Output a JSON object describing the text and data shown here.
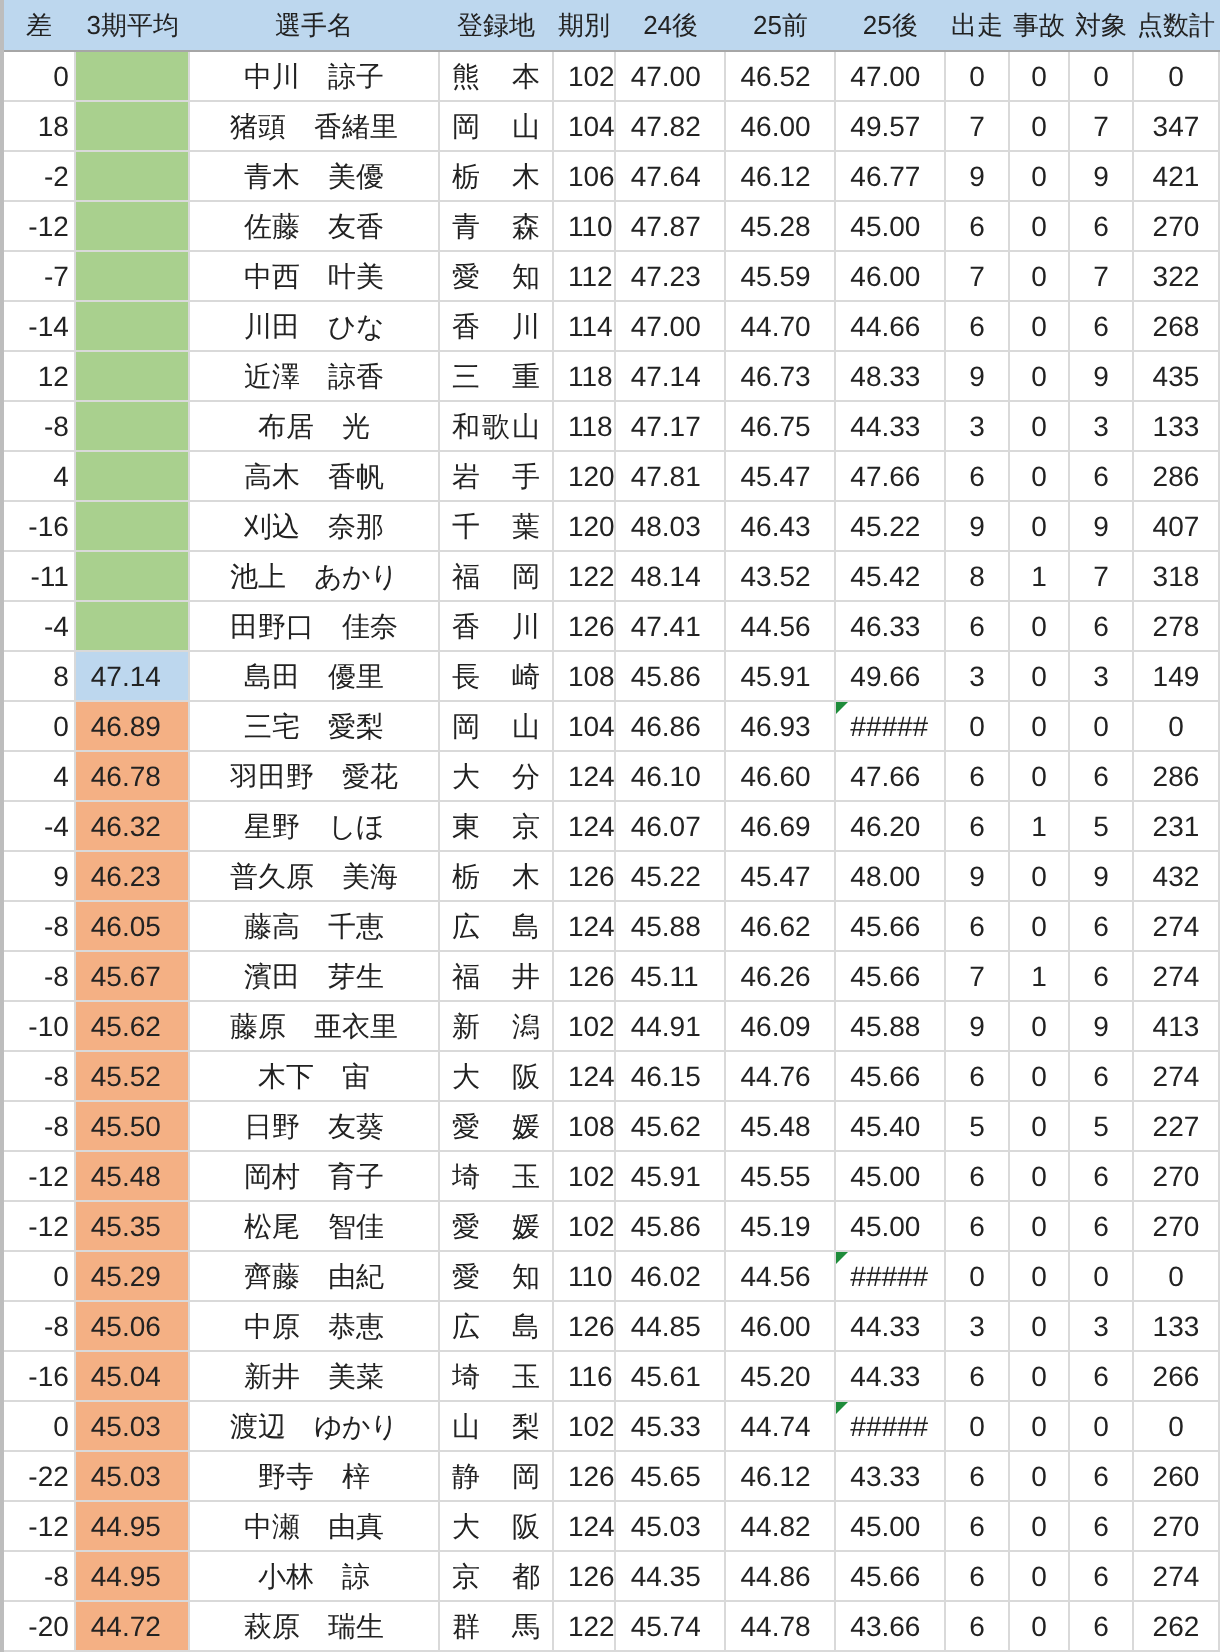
{
  "columns": [
    "差",
    "3期平均",
    "選手名",
    "登録地",
    "期別",
    "24後",
    "25前",
    "25後",
    "出走",
    "事故",
    "対象",
    "点数計"
  ],
  "rows": [
    {
      "diff": "0",
      "color": "#a9d08e",
      "name": "中川　諒子",
      "pref": "熊　本",
      "term": "102",
      "h24": "47.00",
      "f25": "46.52",
      "h25": "47.00",
      "flag": false,
      "starts": "0",
      "accidents": "0",
      "target": "0",
      "points": "0"
    },
    {
      "diff": "18",
      "color": "#a9d08e",
      "name": "猪頭　香緒里",
      "pref": "岡　山",
      "term": "104",
      "h24": "47.82",
      "f25": "46.00",
      "h25": "49.57",
      "flag": false,
      "starts": "7",
      "accidents": "0",
      "target": "7",
      "points": "347"
    },
    {
      "diff": "-2",
      "color": "#a9d08e",
      "name": "青木　美優",
      "pref": "栃　木",
      "term": "106",
      "h24": "47.64",
      "f25": "46.12",
      "h25": "46.77",
      "flag": false,
      "starts": "9",
      "accidents": "0",
      "target": "9",
      "points": "421"
    },
    {
      "diff": "-12",
      "color": "#a9d08e",
      "name": "佐藤　友香",
      "pref": "青　森",
      "term": "110",
      "h24": "47.87",
      "f25": "45.28",
      "h25": "45.00",
      "flag": false,
      "starts": "6",
      "accidents": "0",
      "target": "6",
      "points": "270"
    },
    {
      "diff": "-7",
      "color": "#a9d08e",
      "name": "中西　叶美",
      "pref": "愛　知",
      "term": "112",
      "h24": "47.23",
      "f25": "45.59",
      "h25": "46.00",
      "flag": false,
      "starts": "7",
      "accidents": "0",
      "target": "7",
      "points": "322"
    },
    {
      "diff": "-14",
      "color": "#a9d08e",
      "name": "川田　ひな",
      "pref": "香　川",
      "term": "114",
      "h24": "47.00",
      "f25": "44.70",
      "h25": "44.66",
      "flag": false,
      "starts": "6",
      "accidents": "0",
      "target": "6",
      "points": "268"
    },
    {
      "diff": "12",
      "color": "#a9d08e",
      "name": "近澤　諒香",
      "pref": "三　重",
      "term": "118",
      "h24": "47.14",
      "f25": "46.73",
      "h25": "48.33",
      "flag": false,
      "starts": "9",
      "accidents": "0",
      "target": "9",
      "points": "435"
    },
    {
      "diff": "-8",
      "color": "#a9d08e",
      "name": "布居　光",
      "pref": "和歌山",
      "term": "118",
      "h24": "47.17",
      "f25": "46.75",
      "h25": "44.33",
      "flag": false,
      "starts": "3",
      "accidents": "0",
      "target": "3",
      "points": "133"
    },
    {
      "diff": "4",
      "color": "#a9d08e",
      "name": "高木　香帆",
      "pref": "岩　手",
      "term": "120",
      "h24": "47.81",
      "f25": "45.47",
      "h25": "47.66",
      "flag": false,
      "starts": "6",
      "accidents": "0",
      "target": "6",
      "points": "286"
    },
    {
      "diff": "-16",
      "color": "#a9d08e",
      "name": "刈込　奈那",
      "pref": "千　葉",
      "term": "120",
      "h24": "48.03",
      "f25": "46.43",
      "h25": "45.22",
      "flag": false,
      "starts": "9",
      "accidents": "0",
      "target": "9",
      "points": "407"
    },
    {
      "diff": "-11",
      "color": "#a9d08e",
      "name": "池上　あかり",
      "pref": "福　岡",
      "term": "122",
      "h24": "48.14",
      "f25": "43.52",
      "h25": "45.42",
      "flag": false,
      "starts": "8",
      "accidents": "1",
      "target": "7",
      "points": "318"
    },
    {
      "diff": "-4",
      "color": "#a9d08e",
      "name": "田野口　佳奈",
      "pref": "香　川",
      "term": "126",
      "h24": "47.41",
      "f25": "44.56",
      "h25": "46.33",
      "flag": false,
      "starts": "6",
      "accidents": "0",
      "target": "6",
      "points": "278"
    },
    {
      "diff": "8",
      "avg": "47.14",
      "color": "#bdd7ee",
      "name": "島田　優里",
      "pref": "長　崎",
      "term": "108",
      "h24": "45.86",
      "f25": "45.91",
      "h25": "49.66",
      "flag": false,
      "starts": "3",
      "accidents": "0",
      "target": "3",
      "points": "149"
    },
    {
      "diff": "0",
      "avg": "46.89",
      "color": "#f4b084",
      "name": "三宅　愛梨",
      "pref": "岡　山",
      "term": "104",
      "h24": "46.86",
      "f25": "46.93",
      "h25": "#####",
      "flag": true,
      "starts": "0",
      "accidents": "0",
      "target": "0",
      "points": "0"
    },
    {
      "diff": "4",
      "avg": "46.78",
      "color": "#f4b084",
      "name": "羽田野　愛花",
      "pref": "大　分",
      "term": "124",
      "h24": "46.10",
      "f25": "46.60",
      "h25": "47.66",
      "flag": false,
      "starts": "6",
      "accidents": "0",
      "target": "6",
      "points": "286"
    },
    {
      "diff": "-4",
      "avg": "46.32",
      "color": "#f4b084",
      "name": "星野　しほ",
      "pref": "東　京",
      "term": "124",
      "h24": "46.07",
      "f25": "46.69",
      "h25": "46.20",
      "flag": false,
      "starts": "6",
      "accidents": "1",
      "target": "5",
      "points": "231"
    },
    {
      "diff": "9",
      "avg": "46.23",
      "color": "#f4b084",
      "name": "普久原　美海",
      "pref": "栃　木",
      "term": "126",
      "h24": "45.22",
      "f25": "45.47",
      "h25": "48.00",
      "flag": false,
      "starts": "9",
      "accidents": "0",
      "target": "9",
      "points": "432"
    },
    {
      "diff": "-8",
      "avg": "46.05",
      "color": "#f4b084",
      "name": "藤高　千恵",
      "pref": "広　島",
      "term": "124",
      "h24": "45.88",
      "f25": "46.62",
      "h25": "45.66",
      "flag": false,
      "starts": "6",
      "accidents": "0",
      "target": "6",
      "points": "274"
    },
    {
      "diff": "-8",
      "avg": "45.67",
      "color": "#f4b084",
      "name": "濱田　芽生",
      "pref": "福　井",
      "term": "126",
      "h24": "45.11",
      "f25": "46.26",
      "h25": "45.66",
      "flag": false,
      "starts": "7",
      "accidents": "1",
      "target": "6",
      "points": "274"
    },
    {
      "diff": "-10",
      "avg": "45.62",
      "color": "#f4b084",
      "name": "藤原　亜衣里",
      "pref": "新　潟",
      "term": "102",
      "h24": "44.91",
      "f25": "46.09",
      "h25": "45.88",
      "flag": false,
      "starts": "9",
      "accidents": "0",
      "target": "9",
      "points": "413"
    },
    {
      "diff": "-8",
      "avg": "45.52",
      "color": "#f4b084",
      "name": "木下　宙",
      "pref": "大　阪",
      "term": "124",
      "h24": "46.15",
      "f25": "44.76",
      "h25": "45.66",
      "flag": false,
      "starts": "6",
      "accidents": "0",
      "target": "6",
      "points": "274"
    },
    {
      "diff": "-8",
      "avg": "45.50",
      "color": "#f4b084",
      "name": "日野　友葵",
      "pref": "愛　媛",
      "term": "108",
      "h24": "45.62",
      "f25": "45.48",
      "h25": "45.40",
      "flag": false,
      "starts": "5",
      "accidents": "0",
      "target": "5",
      "points": "227"
    },
    {
      "diff": "-12",
      "avg": "45.48",
      "color": "#f4b084",
      "name": "岡村　育子",
      "pref": "埼　玉",
      "term": "102",
      "h24": "45.91",
      "f25": "45.55",
      "h25": "45.00",
      "flag": false,
      "starts": "6",
      "accidents": "0",
      "target": "6",
      "points": "270"
    },
    {
      "diff": "-12",
      "avg": "45.35",
      "color": "#f4b084",
      "name": "松尾　智佳",
      "pref": "愛　媛",
      "term": "102",
      "h24": "45.86",
      "f25": "45.19",
      "h25": "45.00",
      "flag": false,
      "starts": "6",
      "accidents": "0",
      "target": "6",
      "points": "270"
    },
    {
      "diff": "0",
      "avg": "45.29",
      "color": "#f4b084",
      "name": "齊藤　由紀",
      "pref": "愛　知",
      "term": "110",
      "h24": "46.02",
      "f25": "44.56",
      "h25": "#####",
      "flag": true,
      "starts": "0",
      "accidents": "0",
      "target": "0",
      "points": "0"
    },
    {
      "diff": "-8",
      "avg": "45.06",
      "color": "#f4b084",
      "name": "中原　恭恵",
      "pref": "広　島",
      "term": "126",
      "h24": "44.85",
      "f25": "46.00",
      "h25": "44.33",
      "flag": false,
      "starts": "3",
      "accidents": "0",
      "target": "3",
      "points": "133"
    },
    {
      "diff": "-16",
      "avg": "45.04",
      "color": "#f4b084",
      "name": "新井　美菜",
      "pref": "埼　玉",
      "term": "116",
      "h24": "45.61",
      "f25": "45.20",
      "h25": "44.33",
      "flag": false,
      "starts": "6",
      "accidents": "0",
      "target": "6",
      "points": "266"
    },
    {
      "diff": "0",
      "avg": "45.03",
      "color": "#f4b084",
      "name": "渡辺　ゆかり",
      "pref": "山　梨",
      "term": "102",
      "h24": "45.33",
      "f25": "44.74",
      "h25": "#####",
      "flag": true,
      "starts": "0",
      "accidents": "0",
      "target": "0",
      "points": "0"
    },
    {
      "diff": "-22",
      "avg": "45.03",
      "color": "#f4b084",
      "name": "野寺　梓",
      "pref": "静　岡",
      "term": "126",
      "h24": "45.65",
      "f25": "46.12",
      "h25": "43.33",
      "flag": false,
      "starts": "6",
      "accidents": "0",
      "target": "6",
      "points": "260"
    },
    {
      "diff": "-12",
      "avg": "44.95",
      "color": "#f4b084",
      "name": "中瀬　由真",
      "pref": "大　阪",
      "term": "124",
      "h24": "45.03",
      "f25": "44.82",
      "h25": "45.00",
      "flag": false,
      "starts": "6",
      "accidents": "0",
      "target": "6",
      "points": "270"
    },
    {
      "diff": "-8",
      "avg": "44.95",
      "color": "#f4b084",
      "name": "小林　諒",
      "pref": "京　都",
      "term": "126",
      "h24": "44.35",
      "f25": "44.86",
      "h25": "45.66",
      "flag": false,
      "starts": "6",
      "accidents": "0",
      "target": "6",
      "points": "274"
    },
    {
      "diff": "-20",
      "avg": "44.72",
      "color": "#f4b084",
      "name": "萩原　瑞生",
      "pref": "群　馬",
      "term": "122",
      "h24": "45.74",
      "f25": "44.78",
      "h25": "43.66",
      "flag": false,
      "starts": "6",
      "accidents": "0",
      "target": "6",
      "points": "262"
    }
  ]
}
